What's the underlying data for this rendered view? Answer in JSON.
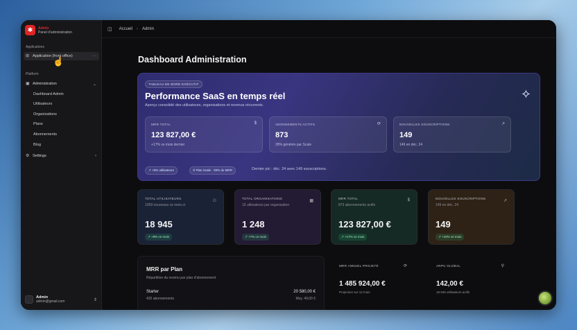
{
  "brand": {
    "name": "Admin",
    "subtitle": "Panel d'administration",
    "logo_icon": "shield-icon"
  },
  "sidebar": {
    "sections": [
      {
        "label": "Applications"
      },
      {
        "label": "Platform"
      }
    ],
    "app_item": {
      "label": "Application (front office)",
      "more": "···"
    },
    "admin_group": {
      "label": "Administration",
      "chevron": "⌄"
    },
    "sub_items": [
      "Dashboard Admin",
      "Utilisateurs",
      "Organizations",
      "Plans",
      "Abonnements",
      "Blog"
    ],
    "settings": {
      "label": "Settings",
      "chevron": "›"
    },
    "user": {
      "name": "Admin",
      "email": "admin@gmail.com",
      "chevron": "⇕"
    }
  },
  "topbar": {
    "breadcrumb": [
      "Accueil",
      "Admin"
    ],
    "separator": "›"
  },
  "page": {
    "title": "Dashboard Administration"
  },
  "hero": {
    "badge": "TABLEAU DE BORD EXÉCUTIF",
    "title": "Performance SaaS en temps réel",
    "subtitle": "Aperçu consolidé des utilisateurs, organisations et revenus récurrents.",
    "cards": [
      {
        "label": "MRR TOTAL",
        "icon": "$",
        "value": "123 827,00 €",
        "note": "+17% vs mois dernier"
      },
      {
        "label": "ABONNEMENTS ACTIFS",
        "icon": "⟳",
        "value": "873",
        "note": "28% générés par Scale"
      },
      {
        "label": "NOUVELLES SOUSCRIPTIONS",
        "icon": "↗",
        "value": "149",
        "note": "149 en déc. 24"
      }
    ],
    "pills": [
      "↗ +8% utilisateurs",
      "⚲ Plan Scale · 28% du MRR"
    ],
    "footer": "Dernier pic : déc. 24 avec 149 souscriptions."
  },
  "stats": [
    {
      "label": "TOTAL UTILISATEURS",
      "sub": "1059 nouveaux ce mois-ci",
      "icon": "👥",
      "value": "18 945",
      "badge": "↗ +8% ce mois",
      "bg": "#1a2236"
    },
    {
      "label": "TOTAL ORGANISATIONS",
      "sub": "15 utilisateurs par organisation",
      "icon": "▦",
      "value": "1 248",
      "badge": "↗ +7% ce mois",
      "bg": "#231a34"
    },
    {
      "label": "MRR TOTAL",
      "sub": "873 abonnements actifs",
      "icon": "$",
      "value": "123 827,00 €",
      "badge": "↗ +17% ce mois",
      "bg": "#152a24"
    },
    {
      "label": "NOUVELLES SOUSCRIPTIONS",
      "sub": "149 en déc. 24",
      "icon": "↗",
      "value": "149",
      "badge": "↗ +10% ce mois",
      "bg": "#2e2216"
    }
  ],
  "mrr_plan": {
    "title": "MRR par Plan",
    "subtitle": "Répartition du revenu par plan d'abonnement",
    "rows": [
      {
        "name": "Starter",
        "count": "420 abonnements",
        "value": "20 580,00 €",
        "avg": "Moy. 49,00 €"
      }
    ]
  },
  "minis": [
    {
      "label": "MRR ANNUEL PROJETÉ",
      "icon": "⟳",
      "value": "1 485 924,00 €",
      "note": "Projection sur 12 mois"
    },
    {
      "label": "ARPU GLOBAL",
      "icon": "👤",
      "value": "142,00 €",
      "note": "18 945 utilisateurs actifs"
    }
  ]
}
